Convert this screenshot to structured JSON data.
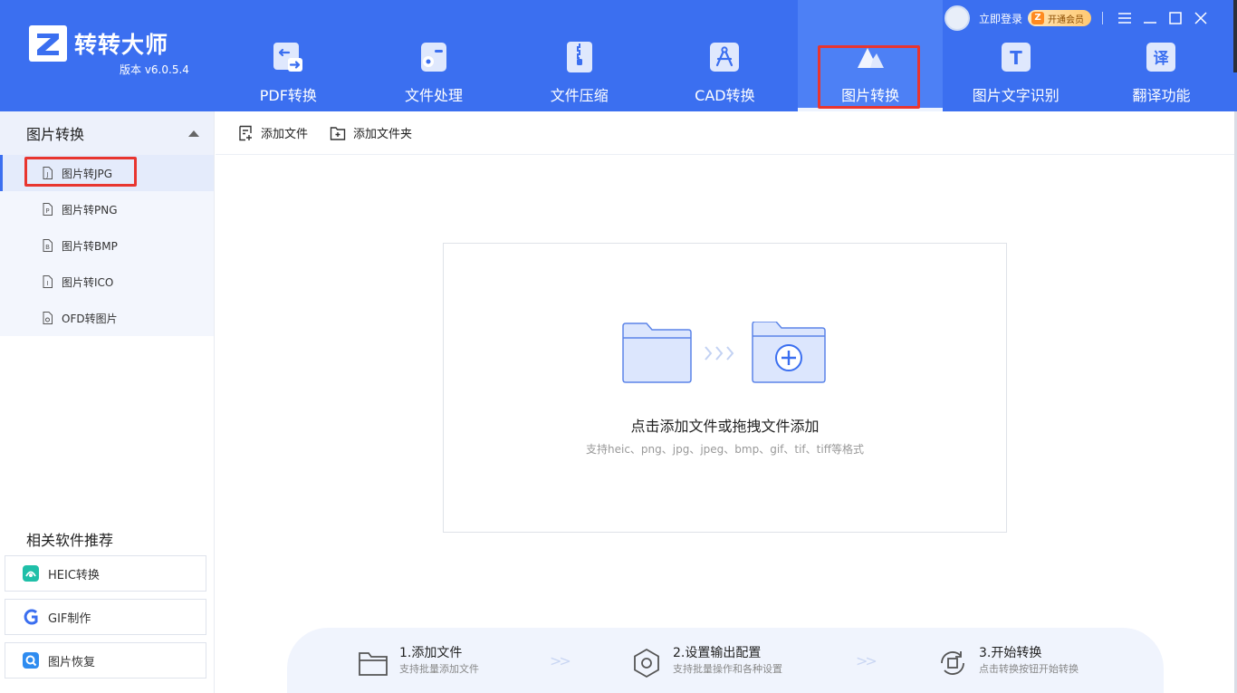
{
  "app": {
    "name": "转转大师",
    "version": "版本 v6.0.5.4"
  },
  "topbar": {
    "login_label": "立即登录",
    "vip_label": "开通会员",
    "vip_badge": "Z"
  },
  "nav": {
    "items": [
      {
        "label": "PDF转换"
      },
      {
        "label": "文件处理"
      },
      {
        "label": "文件压缩"
      },
      {
        "label": "CAD转换"
      },
      {
        "label": "图片转换"
      },
      {
        "label": "图片文字识别"
      },
      {
        "label": "翻译功能"
      }
    ],
    "active_index": 4,
    "ocr_icon_text": "T",
    "translate_icon_text": "译"
  },
  "sidebar": {
    "section_title": "图片转换",
    "items": [
      {
        "label": "图片转JPG",
        "icon_letter": "J"
      },
      {
        "label": "图片转PNG",
        "icon_letter": "P"
      },
      {
        "label": "图片转BMP",
        "icon_letter": "B"
      },
      {
        "label": "图片转ICO",
        "icon_letter": "I"
      },
      {
        "label": "OFD转图片",
        "icon_letter": ""
      }
    ],
    "active_index": 0,
    "recommend_title": "相关软件推荐",
    "recommend": [
      {
        "label": "HEIC转换"
      },
      {
        "label": "GIF制作"
      },
      {
        "label": "图片恢复"
      }
    ]
  },
  "toolbar": {
    "add_file_label": "添加文件",
    "add_folder_label": "添加文件夹"
  },
  "dropzone": {
    "title": "点击添加文件或拖拽文件添加",
    "subtitle": "支持heic、png、jpg、jpeg、bmp、gif、tif、tiff等格式"
  },
  "steps": [
    {
      "title": "1.添加文件",
      "desc": "支持批量添加文件"
    },
    {
      "title": "2.设置输出配置",
      "desc": "支持批量操作和各种设置"
    },
    {
      "title": "3.开始转换",
      "desc": "点击转换按钮开始转换"
    }
  ],
  "colors": {
    "brand": "#3b6ff0",
    "highlight": "#e8352f"
  }
}
